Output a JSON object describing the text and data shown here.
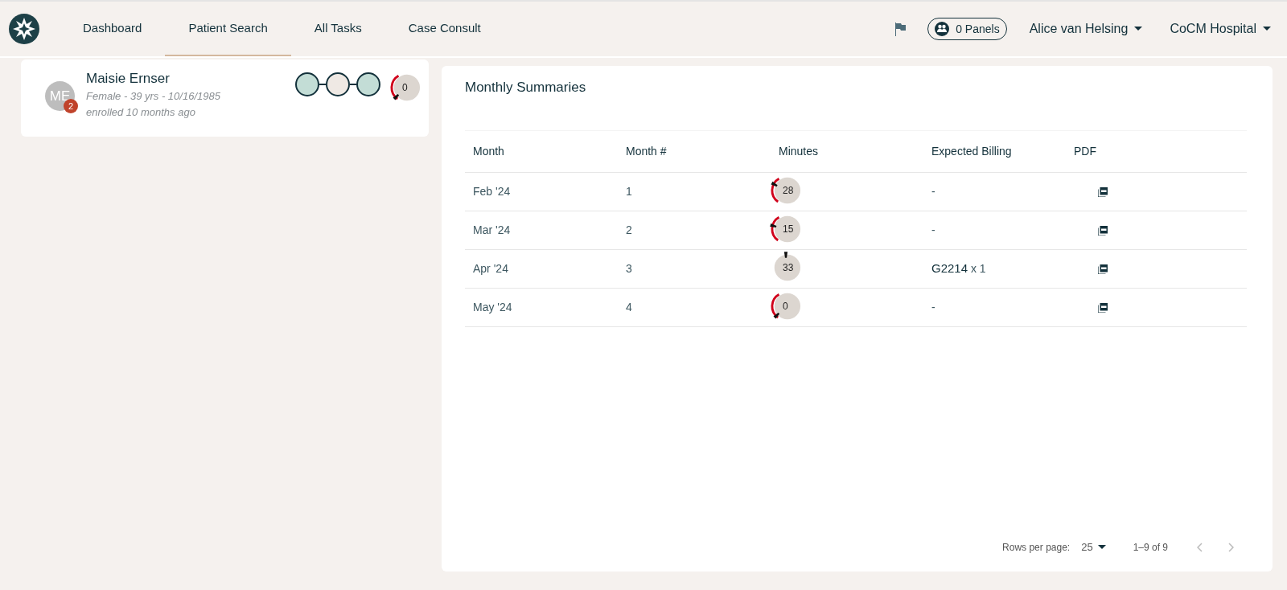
{
  "nav": {
    "tabs": [
      {
        "label": "Dashboard",
        "selected": false
      },
      {
        "label": "Patient Search",
        "selected": true
      },
      {
        "label": "All Tasks",
        "selected": false
      },
      {
        "label": "Case Consult",
        "selected": false
      }
    ],
    "panels_button": "0 Panels",
    "user_menu": "Alice van Helsing",
    "org_menu": "CoCM Hospital"
  },
  "patient": {
    "initials": "ME",
    "badge": "2",
    "name": "Maisie Ernser",
    "details": "Female - 39 yrs - 10/16/1985",
    "enrolled": "enrolled 10 months ago",
    "status_steps": [
      {
        "color": "#c3ddd6"
      },
      {
        "color": "#efe9e4"
      },
      {
        "color": "#c3ddd6"
      }
    ],
    "gauge": {
      "value": "0",
      "level": 0,
      "alert": true
    }
  },
  "summaries": {
    "title": "Monthly Summaries",
    "columns": [
      "Month",
      "Month #",
      "Minutes",
      "Expected Billing",
      "PDF"
    ],
    "rows": [
      {
        "month": "Feb '24",
        "number": "1",
        "minutes": {
          "value": "28",
          "level": 0.27,
          "alert": true
        },
        "billing_code": "",
        "billing_rest": "-"
      },
      {
        "month": "Mar '24",
        "number": "2",
        "minutes": {
          "value": "15",
          "level": 0.22,
          "alert": true
        },
        "billing_code": "",
        "billing_rest": "-"
      },
      {
        "month": "Apr '24",
        "number": "3",
        "minutes": {
          "value": "33",
          "level": 0.5,
          "alert": false
        },
        "billing_code": "G2214",
        "billing_rest": "x 1"
      },
      {
        "month": "May '24",
        "number": "4",
        "minutes": {
          "value": "0",
          "level": 0,
          "alert": true
        },
        "billing_code": "",
        "billing_rest": "-"
      }
    ],
    "pagination": {
      "rows_label": "Rows per page:",
      "rows_value": "25",
      "range": "1–9 of 9"
    }
  }
}
